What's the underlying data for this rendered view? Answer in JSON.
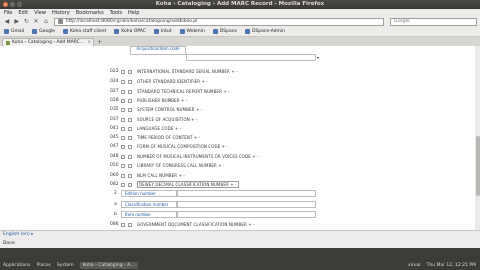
{
  "window": {
    "title": "Koha › Cataloging › Add MARC Record - Mozilla Firefox"
  },
  "menu": [
    "File",
    "Edit",
    "View",
    "History",
    "Bookmarks",
    "Tools",
    "Help"
  ],
  "address": {
    "url": "http://localhost:8080/cgi-bin/koha/cataloguing/addbiblio.pl"
  },
  "search": {
    "placeholder": "Google"
  },
  "bookmarks": [
    "Gmail",
    "Google",
    "Koha staff client",
    "Koha OPAC",
    "Intut",
    "Webmin",
    "DSpace",
    "DSpace-Admin"
  ],
  "tab": {
    "label": "Koha › Cataloging › Add MARC..."
  },
  "top_subfield": {
    "label": "Acquisition/item code"
  },
  "fields": [
    {
      "tag": "022",
      "label": "INTERNATIONAL STANDARD SERIAL NUMBER"
    },
    {
      "tag": "024",
      "label": "OTHER STANDARD IDENTIFIER"
    },
    {
      "tag": "027",
      "label": "STANDARD TECHNICAL REPORT NUMBER"
    },
    {
      "tag": "028",
      "label": "PUBLISHER NUMBER"
    },
    {
      "tag": "035",
      "label": "SYSTEM CONTROL NUMBER"
    },
    {
      "tag": "037",
      "label": "SOURCE OF ACQUISITION"
    },
    {
      "tag": "041",
      "label": "LANGUAGE CODE"
    },
    {
      "tag": "045",
      "label": "TIME PERIOD OF CONTENT"
    },
    {
      "tag": "047",
      "label": "FORM OF MUSICAL COMPOSITION CODE"
    },
    {
      "tag": "048",
      "label": "NUMBER OF MUSICAL INSTRUMENTS OR VOICES CODE"
    },
    {
      "tag": "050",
      "label": "LIBRARY OF CONGRESS CALL NUMBER"
    },
    {
      "tag": "060",
      "label": "NLM CALL NUMBER"
    },
    {
      "tag": "082",
      "label": "DEWEY DECIMAL CLASSIFICATION NUMBER"
    }
  ],
  "subfields": [
    {
      "code": "2",
      "label": "Edition number"
    },
    {
      "code": "a",
      "label": "Classification number"
    },
    {
      "code": "b",
      "label": "Item number"
    }
  ],
  "last_field": {
    "tag": "086",
    "label": "GOVERNMENT DOCUMENT CLASSIFICATION NUMBER"
  },
  "status": {
    "link": "English (en) ▸",
    "done": "Done"
  },
  "taskbar": {
    "applications": "Applications",
    "places": "Places",
    "system": "System",
    "app": "Koha › Cataloging › A...",
    "user": "virual",
    "clock": "Thu Mar 12, 12:21 PM"
  }
}
